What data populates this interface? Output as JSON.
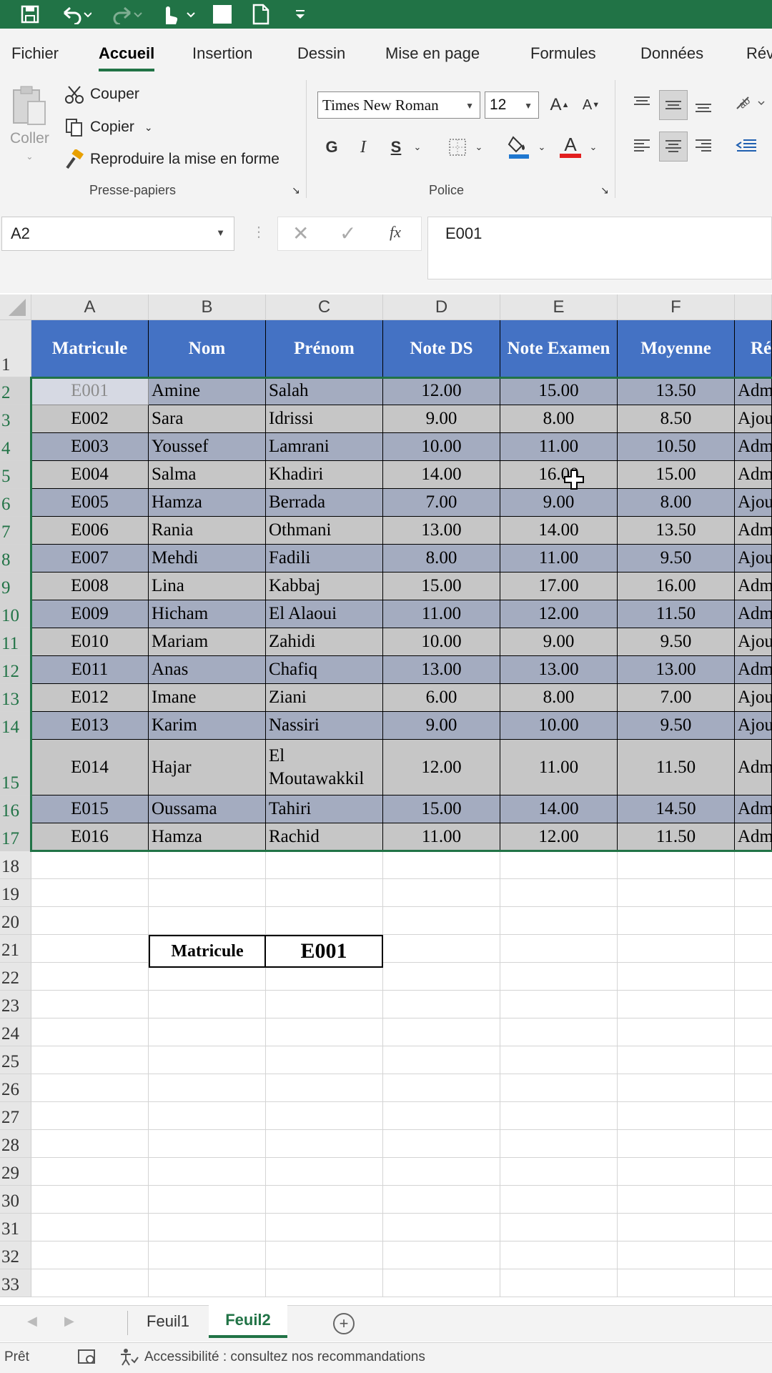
{
  "ribbon_tabs": [
    "Fichier",
    "Accueil",
    "Insertion",
    "Dessin",
    "Mise en page",
    "Formules",
    "Données",
    "Rév"
  ],
  "clipboard": {
    "paste": "Coller",
    "cut": "Couper",
    "copy": "Copier",
    "format_painter": "Reproduire la mise en forme",
    "group_label": "Presse-papiers"
  },
  "font": {
    "name": "Times New Roman",
    "size": "12",
    "bold": "G",
    "italic": "I",
    "strike": "S",
    "grow": "A",
    "shrink": "A",
    "color_letter": "A",
    "group_label": "Police"
  },
  "formula_bar": {
    "name_box": "A2",
    "fx": "fx",
    "value": "E001"
  },
  "columns": [
    "A",
    "B",
    "C",
    "D",
    "E",
    "F"
  ],
  "rows": [
    "1",
    "2",
    "3",
    "4",
    "5",
    "6",
    "7",
    "8",
    "9",
    "10",
    "11",
    "12",
    "13",
    "14",
    "15",
    "16",
    "17",
    "18",
    "19",
    "20",
    "21",
    "22",
    "23",
    "24",
    "25",
    "26",
    "27",
    "28",
    "29",
    "30",
    "31",
    "32",
    "33"
  ],
  "table": {
    "headers": [
      "Matricule",
      "Nom",
      "Prénom",
      "Note DS",
      "Note Examen",
      "Moyenne",
      "Ré"
    ],
    "rows": [
      [
        "E001",
        "Amine",
        "Salah",
        "12.00",
        "15.00",
        "13.50",
        "Adm"
      ],
      [
        "E002",
        "Sara",
        "Idrissi",
        "9.00",
        "8.00",
        "8.50",
        "Ajou"
      ],
      [
        "E003",
        "Youssef",
        "Lamrani",
        "10.00",
        "11.00",
        "10.50",
        "Adm"
      ],
      [
        "E004",
        "Salma",
        "Khadiri",
        "14.00",
        "16.00",
        "15.00",
        "Adm"
      ],
      [
        "E005",
        "Hamza",
        "Berrada",
        "7.00",
        "9.00",
        "8.00",
        "Ajou"
      ],
      [
        "E006",
        "Rania",
        "Othmani",
        "13.00",
        "14.00",
        "13.50",
        "Adm"
      ],
      [
        "E007",
        "Mehdi",
        "Fadili",
        "8.00",
        "11.00",
        "9.50",
        "Ajou"
      ],
      [
        "E008",
        "Lina",
        "Kabbaj",
        "15.00",
        "17.00",
        "16.00",
        "Adm"
      ],
      [
        "E009",
        "Hicham",
        "El Alaoui",
        "11.00",
        "12.00",
        "11.50",
        "Adm"
      ],
      [
        "E010",
        "Mariam",
        "Zahidi",
        "10.00",
        "9.00",
        "9.50",
        "Ajou"
      ],
      [
        "E011",
        "Anas",
        "Chafiq",
        "13.00",
        "13.00",
        "13.00",
        "Adm"
      ],
      [
        "E012",
        "Imane",
        "Ziani",
        "6.00",
        "8.00",
        "7.00",
        "Ajou"
      ],
      [
        "E013",
        "Karim",
        "Nassiri",
        "9.00",
        "10.00",
        "9.50",
        "Ajou"
      ],
      [
        "E014",
        "Hajar",
        "El Moutawakkil",
        "12.00",
        "11.00",
        "11.50",
        "Adm"
      ],
      [
        "E015",
        "Oussama",
        "Tahiri",
        "15.00",
        "14.00",
        "14.50",
        "Adm"
      ],
      [
        "E016",
        "Hamza",
        "Rachid",
        "11.00",
        "12.00",
        "11.50",
        "Adm"
      ]
    ]
  },
  "lookup": {
    "label": "Matricule",
    "value": "E001"
  },
  "sheets": [
    "Feuil1",
    "Feuil2"
  ],
  "active_sheet": "Feuil2",
  "status": {
    "ready": "Prêt",
    "accessibility": "Accessibilité : consultez nos recommandations"
  },
  "colors": {
    "excel_green": "#217346",
    "header_blue": "#4472c4",
    "band_blue": "#a4acc0",
    "band_gray": "#c6c6c6"
  }
}
